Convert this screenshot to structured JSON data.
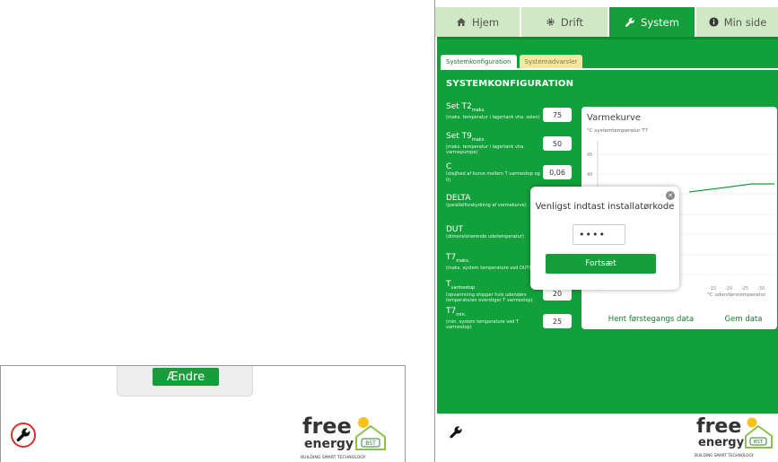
{
  "left": {
    "change_button": "Ændre",
    "icons": {
      "settings": "wrench-icon"
    }
  },
  "logo": {
    "word1": "free",
    "word2": "energy",
    "badge": "BST",
    "tagline": "BUILDING SMART TECHNOLOGY"
  },
  "nav": {
    "tabs": [
      {
        "label": "Hjem",
        "icon": "home-icon"
      },
      {
        "label": "Drift",
        "icon": "gear-icon"
      },
      {
        "label": "System",
        "icon": "wrench-icon",
        "active": true
      },
      {
        "label": "Min side",
        "icon": "info-icon"
      }
    ]
  },
  "subtabs": {
    "config": "Systemkonfiguration",
    "warnings": "Systemadvarsler"
  },
  "section_title": "SYSTEMKONFIGURATION",
  "params": [
    {
      "name": "Set T2",
      "sub": "maks.",
      "desc": "(maks. temperatur i lagertank vha. solen)",
      "value": "75"
    },
    {
      "name": "Set T9",
      "sub": "maks.",
      "desc": "(maks. temperatur i lagertank vha. varmepumpe)",
      "value": "50"
    },
    {
      "name": "C",
      "sub": "",
      "desc": "(stejlhed af kurve mellem T varmestop og 0)",
      "value": "0,06"
    },
    {
      "name": "DELTA",
      "sub": "",
      "desc": "(parallelforskydning af varmekurve)",
      "value": ""
    },
    {
      "name": "DUT",
      "sub": "",
      "desc": "(dimensionerende udetemperatur)",
      "value": ""
    },
    {
      "name": "T7",
      "sub": "maks.",
      "desc": "(maks. system temperature ved DUT)",
      "value": ""
    },
    {
      "name": "T",
      "sub": "varmestop",
      "desc": "(opvarmning stopper hvis udendørs temperaturen overstiger T varmestop)",
      "value": "20"
    },
    {
      "name": "T7",
      "sub": "min.",
      "desc": "(min. system temperature ved T varmestop)",
      "value": "25"
    }
  ],
  "chart": {
    "title": "Varmekurve",
    "ylabel": "°C systemtemperatur T7",
    "xlabel": "°C udendørstemperatur",
    "yticks": [
      "45",
      "40"
    ],
    "xticks": [
      "-15",
      "-20",
      "-25",
      "-30"
    ]
  },
  "buttons": {
    "load_first": "Hent førstegangs data",
    "save": "Gem data"
  },
  "modal": {
    "title": "Venligst indtast installatørkode",
    "input_value": "••••",
    "continue": "Fortsæt",
    "close_icon": "close-icon"
  },
  "colors": {
    "green": "#169e3a",
    "light_green": "#cfe9c4",
    "yellow_tab": "#f2e8a6",
    "alert_red": "#d9302b"
  }
}
